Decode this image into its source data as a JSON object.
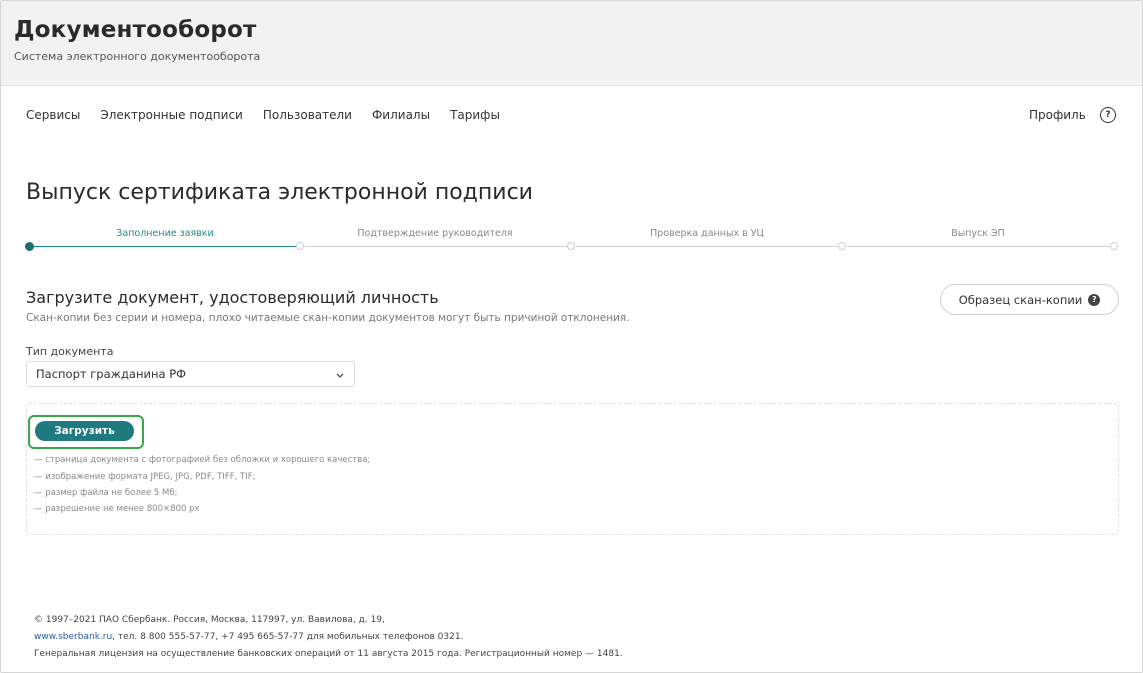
{
  "header": {
    "title": "Документооборот",
    "subtitle": "Система электронного документооборота"
  },
  "nav": {
    "items": [
      "Сервисы",
      "Электронные подписи",
      "Пользователи",
      "Филиалы",
      "Тарифы"
    ],
    "profile": "Профиль",
    "help": "?"
  },
  "page": {
    "title": "Выпуск сертификата электронной подписи"
  },
  "stepper": {
    "steps": [
      {
        "label": "Заполнение заявки",
        "active": true
      },
      {
        "label": "Подтверждение руководителя",
        "active": false
      },
      {
        "label": "Проверка данных в УЦ",
        "active": false
      },
      {
        "label": "Выпуск ЭП",
        "active": false
      }
    ],
    "active_color": "#1f8c8c"
  },
  "section": {
    "title": "Загрузите документ, удостоверяющий личность",
    "description": "Скан-копии без серии и номера, плохо читаемые скан-копии документов могут быть причиной отклонения.",
    "sample_button": "Образец скан-копии",
    "sample_icon": "question-icon"
  },
  "form": {
    "doc_type_label": "Тип документа",
    "doc_type_value": "Паспорт гражданина РФ"
  },
  "upload": {
    "button_label": "Загрузить",
    "button_color": "#1f7a80",
    "highlight_color": "#3aa54a",
    "requirements": [
      "— страница документа с фотографией без обложки и хорошего качества;",
      "— изображение формата JPEG, JPG, PDF, TIFF, TIF;",
      "— размер файла не более 5 Мб;",
      "— разрешение не менее 800×800 px"
    ]
  },
  "footer": {
    "line1": "© 1997–2021 ПАО Сбербанк. Россия, Москва, 117997, ул. Вавилова, д. 19,",
    "link": "www.sberbank.ru",
    "line2_rest": ", тел. 8 800 555-57-77, +7 495 665-57-77 для мобильных телефонов 0321.",
    "line3": "Генеральная лицензия на осуществление банковских операций от 11 августа 2015 года. Регистрационный номер — 1481."
  }
}
